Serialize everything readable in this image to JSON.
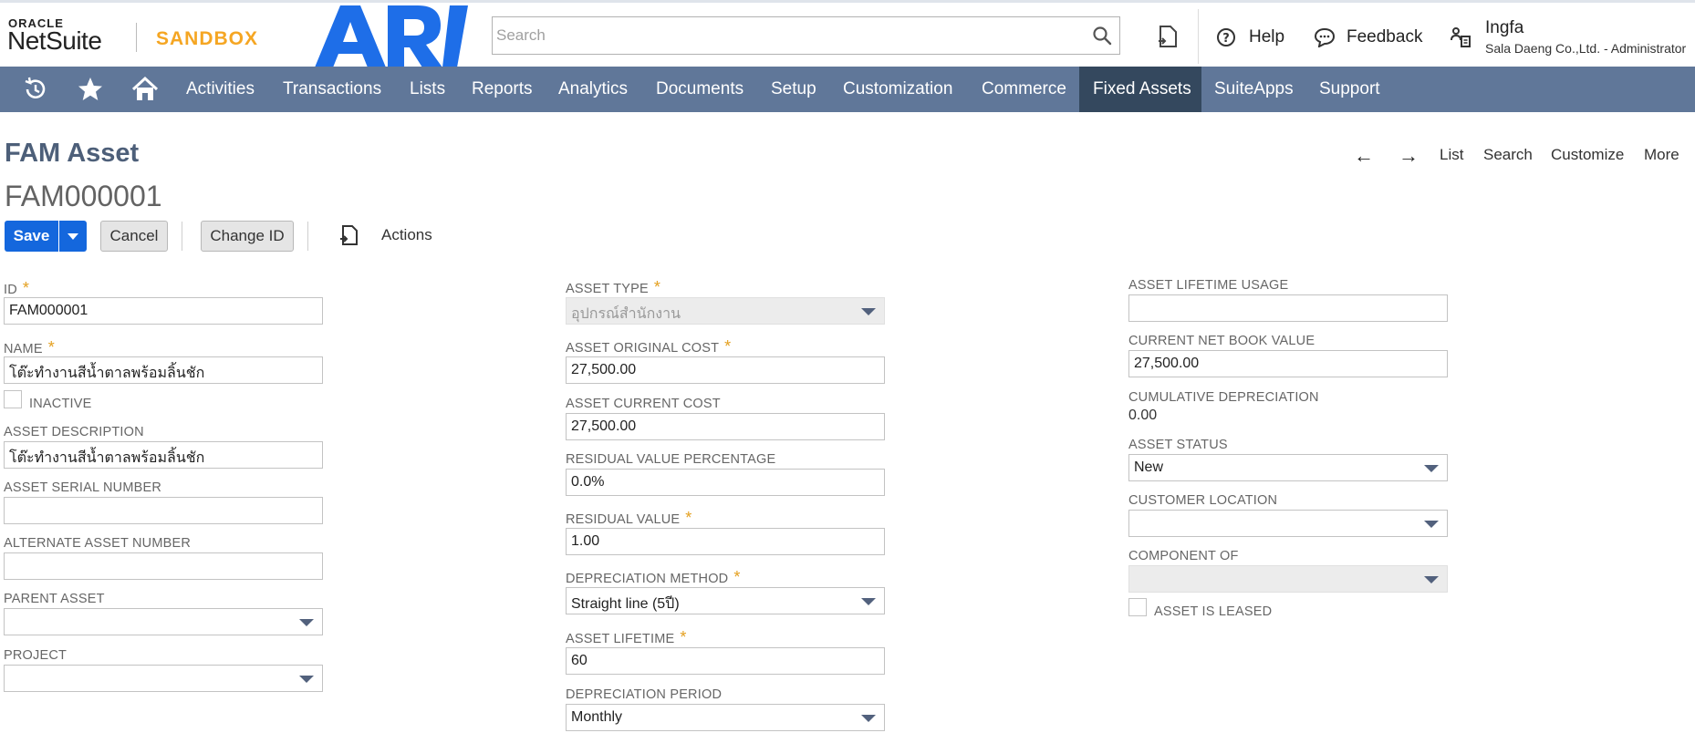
{
  "header": {
    "oracle_label": "ORACLE",
    "netsuite_label": "NetSuite",
    "sandbox_label": "SANDBOX",
    "search_placeholder": "Search",
    "help_label": "Help",
    "feedback_label": "Feedback",
    "user_name": "Ingfa",
    "user_role": "Sala Daeng Co.,Ltd. - Administrator",
    "brand_color": "#f5a623",
    "logo_color": "#1e6ee8"
  },
  "nav": {
    "items": [
      "Activities",
      "Transactions",
      "Lists",
      "Reports",
      "Analytics",
      "Documents",
      "Setup",
      "Customization",
      "Commerce",
      "Fixed Assets",
      "SuiteApps",
      "Support"
    ],
    "active": "Fixed Assets",
    "bar_color": "#607799"
  },
  "page": {
    "title": "FAM Asset",
    "record_id": "FAM000001",
    "record_nav": {
      "list": "List",
      "search": "Search",
      "customize": "Customize",
      "more": "More"
    }
  },
  "buttons": {
    "save": "Save",
    "cancel": "Cancel",
    "change_id": "Change ID",
    "actions": "Actions"
  },
  "form": {
    "col1": {
      "id_label": "ID",
      "id_value": "FAM000001",
      "name_label": "NAME",
      "name_value": "โต๊ะทำงานสีน้ำตาลพร้อมลิ้นชัก",
      "inactive_label": "INACTIVE",
      "desc_label": "ASSET DESCRIPTION",
      "desc_value": "โต๊ะทำงานสีน้ำตาลพร้อมลิ้นชัก",
      "serial_label": "ASSET SERIAL NUMBER",
      "serial_value": "",
      "alt_label": "ALTERNATE ASSET NUMBER",
      "alt_value": "",
      "parent_label": "PARENT ASSET",
      "parent_value": "",
      "project_label": "PROJECT",
      "project_value": ""
    },
    "col2": {
      "type_label": "ASSET TYPE",
      "type_value": "อุปกรณ์สำนักงาน",
      "orig_cost_label": "ASSET ORIGINAL COST",
      "orig_cost_value": "27,500.00",
      "curr_cost_label": "ASSET CURRENT COST",
      "curr_cost_value": "27,500.00",
      "resid_pct_label": "RESIDUAL VALUE PERCENTAGE",
      "resid_pct_value": "0.0%",
      "resid_label": "RESIDUAL VALUE",
      "resid_value": "1.00",
      "dep_method_label": "DEPRECIATION METHOD",
      "dep_method_value": "Straight line (5ปี)",
      "lifetime_label": "ASSET LIFETIME",
      "lifetime_value": "60",
      "dep_period_label": "DEPRECIATION PERIOD",
      "dep_period_value": "Monthly"
    },
    "col3": {
      "usage_label": "ASSET LIFETIME USAGE",
      "usage_value": "",
      "nbv_label": "CURRENT NET BOOK VALUE",
      "nbv_value": "27,500.00",
      "cum_dep_label": "CUMULATIVE DEPRECIATION",
      "cum_dep_value": "0.00",
      "status_label": "ASSET STATUS",
      "status_value": "New",
      "cust_loc_label": "CUSTOMER LOCATION",
      "cust_loc_value": "",
      "component_label": "COMPONENT OF",
      "component_value": "",
      "leased_label": "ASSET IS LEASED"
    }
  }
}
